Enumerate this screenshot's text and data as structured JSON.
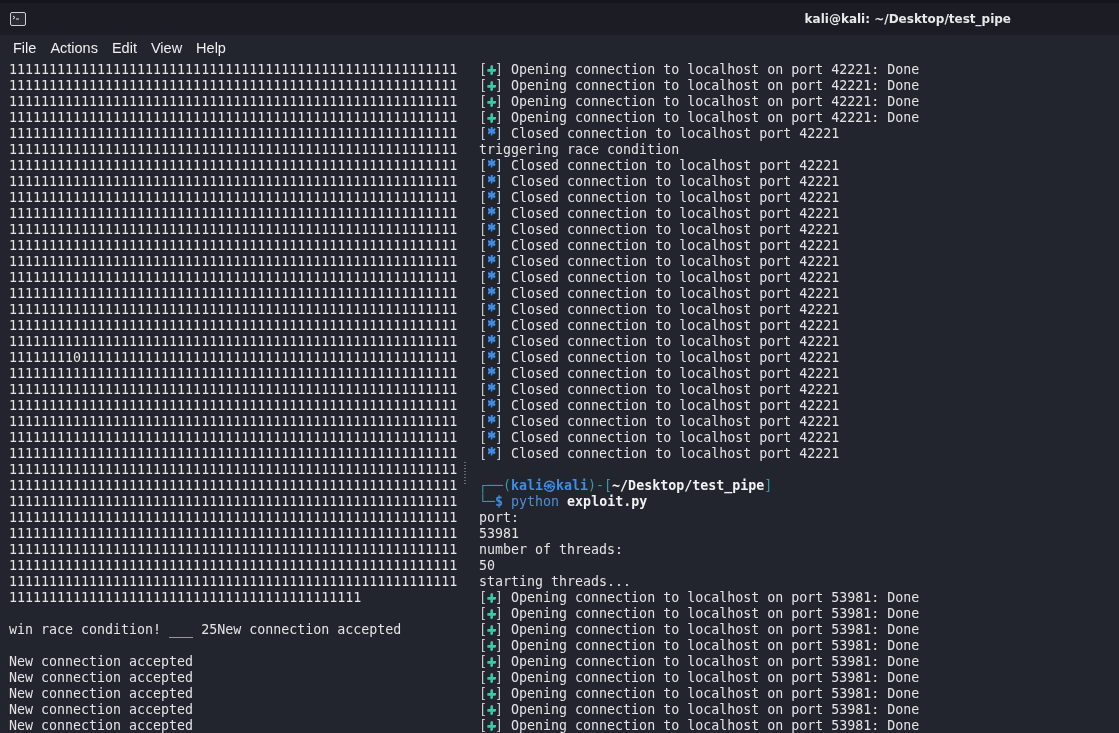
{
  "window": {
    "title": "kali@kali: ~/Desktop/test_pipe"
  },
  "menu": [
    "File",
    "Actions",
    "Edit",
    "View",
    "Help"
  ],
  "left_pane": {
    "lines": [
      {
        "kind": "text",
        "text": "11111111111111111111111111111111111111111111111111111111"
      },
      {
        "kind": "text",
        "text": "11111111111111111111111111111111111111111111111111111111"
      },
      {
        "kind": "text",
        "text": "11111111111111111111111111111111111111111111111111111111"
      },
      {
        "kind": "text",
        "text": "11111111111111111111111111111111111111111111111111111111"
      },
      {
        "kind": "text",
        "text": "11111111111111111111111111111111111111111111111111111111"
      },
      {
        "kind": "text",
        "text": "11111111111111111111111111111111111111111111111111111111"
      },
      {
        "kind": "text",
        "text": "11111111111111111111111111111111111111111111111111111111"
      },
      {
        "kind": "text",
        "text": "11111111111111111111111111111111111111111111111111111111"
      },
      {
        "kind": "text",
        "text": "11111111111111111111111111111111111111111111111111111111"
      },
      {
        "kind": "text",
        "text": "11111111111111111111111111111111111111111111111111111111"
      },
      {
        "kind": "text",
        "text": "11111111111111111111111111111111111111111111111111111111"
      },
      {
        "kind": "text",
        "text": "11111111111111111111111111111111111111111111111111111111"
      },
      {
        "kind": "text",
        "text": "11111111111111111111111111111111111111111111111111111111"
      },
      {
        "kind": "text",
        "text": "11111111111111111111111111111111111111111111111111111111"
      },
      {
        "kind": "text",
        "text": "11111111111111111111111111111111111111111111111111111111"
      },
      {
        "kind": "text",
        "text": "11111111111111111111111111111111111111111111111111111111"
      },
      {
        "kind": "text",
        "text": "11111111111111111111111111111111111111111111111111111111"
      },
      {
        "kind": "text",
        "text": "11111111111111111111111111111111111111111111111111111111"
      },
      {
        "kind": "text",
        "text": "11111111011111111111111111111111111111111111111111111111"
      },
      {
        "kind": "text",
        "text": "11111111111111111111111111111111111111111111111111111111"
      },
      {
        "kind": "text",
        "text": "11111111111111111111111111111111111111111111111111111111"
      },
      {
        "kind": "text",
        "text": "11111111111111111111111111111111111111111111111111111111"
      },
      {
        "kind": "text",
        "text": "11111111111111111111111111111111111111111111111111111111"
      },
      {
        "kind": "text",
        "text": "11111111111111111111111111111111111111111111111111111111"
      },
      {
        "kind": "text",
        "text": "11111111111111111111111111111111111111111111111111111111"
      },
      {
        "kind": "text",
        "text": "11111111111111111111111111111111111111111111111111111111"
      },
      {
        "kind": "text",
        "text": "11111111111111111111111111111111111111111111111111111111"
      },
      {
        "kind": "text",
        "text": "11111111111111111111111111111111111111111111111111111111"
      },
      {
        "kind": "text",
        "text": "11111111111111111111111111111111111111111111111111111111"
      },
      {
        "kind": "text",
        "text": "11111111111111111111111111111111111111111111111111111111"
      },
      {
        "kind": "text",
        "text": "11111111111111111111111111111111111111111111111111111111"
      },
      {
        "kind": "text",
        "text": "11111111111111111111111111111111111111111111111111111111"
      },
      {
        "kind": "text",
        "text": "11111111111111111111111111111111111111111111111111111111"
      },
      {
        "kind": "text",
        "text": "11111111111111111111111111111111111111111111"
      },
      {
        "kind": "blank"
      },
      {
        "kind": "text",
        "text": "win race condition! ___ 25New connection accepted"
      },
      {
        "kind": "blank"
      },
      {
        "kind": "text",
        "text": "New connection accepted"
      },
      {
        "kind": "text",
        "text": "New connection accepted"
      },
      {
        "kind": "text",
        "text": "New connection accepted"
      },
      {
        "kind": "text",
        "text": "New connection accepted"
      },
      {
        "kind": "text",
        "text": "New connection accepted"
      }
    ]
  },
  "right_pane": {
    "lines": [
      {
        "kind": "status",
        "color": "#3cc9a6",
        "text": "[+] Opening connection to localhost on port 42221: Done"
      },
      {
        "kind": "status",
        "color": "#3cc9a6",
        "text": "[+] Opening connection to localhost on port 42221: Done"
      },
      {
        "kind": "status",
        "color": "#3cc9a6",
        "text": "[+] Opening connection to localhost on port 42221: Done"
      },
      {
        "kind": "status",
        "color": "#3cc9a6",
        "text": "[+] Opening connection to localhost on port 42221: Done"
      },
      {
        "kind": "status",
        "color": "#3d8ee6",
        "text": "[*] Closed connection to localhost port 42221"
      },
      {
        "kind": "text",
        "text": "triggering race condition"
      },
      {
        "kind": "status",
        "color": "#3d8ee6",
        "text": "[*] Closed connection to localhost port 42221"
      },
      {
        "kind": "status",
        "color": "#3d8ee6",
        "text": "[*] Closed connection to localhost port 42221"
      },
      {
        "kind": "status",
        "color": "#3d8ee6",
        "text": "[*] Closed connection to localhost port 42221"
      },
      {
        "kind": "status",
        "color": "#3d8ee6",
        "text": "[*] Closed connection to localhost port 42221"
      },
      {
        "kind": "status",
        "color": "#3d8ee6",
        "text": "[*] Closed connection to localhost port 42221"
      },
      {
        "kind": "status",
        "color": "#3d8ee6",
        "text": "[*] Closed connection to localhost port 42221"
      },
      {
        "kind": "status",
        "color": "#3d8ee6",
        "text": "[*] Closed connection to localhost port 42221"
      },
      {
        "kind": "status",
        "color": "#3d8ee6",
        "text": "[*] Closed connection to localhost port 42221"
      },
      {
        "kind": "status",
        "color": "#3d8ee6",
        "text": "[*] Closed connection to localhost port 42221"
      },
      {
        "kind": "status",
        "color": "#3d8ee6",
        "text": "[*] Closed connection to localhost port 42221"
      },
      {
        "kind": "status",
        "color": "#3d8ee6",
        "text": "[*] Closed connection to localhost port 42221"
      },
      {
        "kind": "status",
        "color": "#3d8ee6",
        "text": "[*] Closed connection to localhost port 42221"
      },
      {
        "kind": "status",
        "color": "#3d8ee6",
        "text": "[*] Closed connection to localhost port 42221"
      },
      {
        "kind": "status",
        "color": "#3d8ee6",
        "text": "[*] Closed connection to localhost port 42221"
      },
      {
        "kind": "status",
        "color": "#3d8ee6",
        "text": "[*] Closed connection to localhost port 42221"
      },
      {
        "kind": "status",
        "color": "#3d8ee6",
        "text": "[*] Closed connection to localhost port 42221"
      },
      {
        "kind": "status",
        "color": "#3d8ee6",
        "text": "[*] Closed connection to localhost port 42221"
      },
      {
        "kind": "status",
        "color": "#3d8ee6",
        "text": "[*] Closed connection to localhost port 42221"
      },
      {
        "kind": "status",
        "color": "#3d8ee6",
        "text": "[*] Closed connection to localhost port 42221"
      },
      {
        "kind": "blank"
      },
      {
        "kind": "prompt",
        "corner": "┌──(",
        "user": "kali㉿kali",
        "separator": ")-[",
        "path": "~/Desktop/test_pipe",
        "close": "]"
      },
      {
        "kind": "command",
        "corner": "└─",
        "sigil": "$",
        "command": "python",
        "argument": "exploit.py"
      },
      {
        "kind": "text",
        "text": "port:"
      },
      {
        "kind": "text",
        "text": "53981"
      },
      {
        "kind": "text",
        "text": "number of threads:"
      },
      {
        "kind": "text",
        "text": "50"
      },
      {
        "kind": "text",
        "text": "starting threads..."
      },
      {
        "kind": "status",
        "color": "#3cc9a6",
        "text": "[+] Opening connection to localhost on port 53981: Done"
      },
      {
        "kind": "status",
        "color": "#3cc9a6",
        "text": "[+] Opening connection to localhost on port 53981: Done"
      },
      {
        "kind": "status",
        "color": "#3cc9a6",
        "text": "[+] Opening connection to localhost on port 53981: Done"
      },
      {
        "kind": "status",
        "color": "#3cc9a6",
        "text": "[+] Opening connection to localhost on port 53981: Done"
      },
      {
        "kind": "status",
        "color": "#3cc9a6",
        "text": "[+] Opening connection to localhost on port 53981: Done"
      },
      {
        "kind": "status",
        "color": "#3cc9a6",
        "text": "[+] Opening connection to localhost on port 53981: Done"
      },
      {
        "kind": "status",
        "color": "#3cc9a6",
        "text": "[+] Opening connection to localhost on port 53981: Done"
      },
      {
        "kind": "status",
        "color": "#3cc9a6",
        "text": "[+] Opening connection to localhost on port 53981: Done"
      },
      {
        "kind": "status",
        "color": "#3cc9a6",
        "text": "[+] Opening connection to localhost on port 53981: Done"
      }
    ]
  }
}
